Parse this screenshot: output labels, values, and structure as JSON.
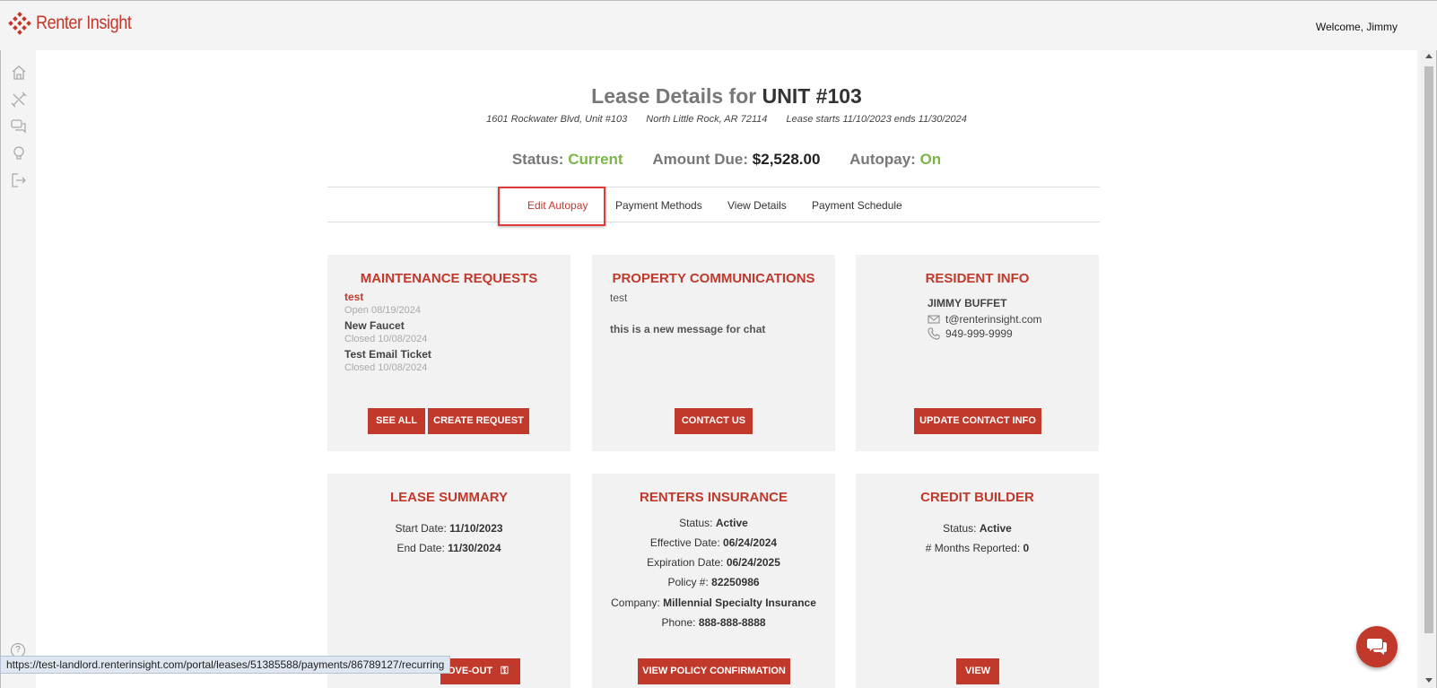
{
  "brand": {
    "name": "Renter Insight",
    "accent": "#c0392b"
  },
  "header": {
    "welcome": "Welcome, Jimmy"
  },
  "nav": {
    "icons": [
      "home-icon",
      "tools-icon",
      "chat-icon",
      "lightbulb-icon",
      "logout-icon"
    ]
  },
  "lease": {
    "title_prefix": "Lease Details for",
    "unit": "UNIT #103",
    "address": "1601 Rockwater Blvd, Unit #103",
    "city": "North Little Rock, AR 72114",
    "term": "Lease starts 11/10/2023 ends 11/30/2024"
  },
  "status_line": {
    "status_label": "Status:",
    "status_value": "Current",
    "amount_label": "Amount Due:",
    "amount_value": "$2,528.00",
    "autopay_label": "Autopay:",
    "autopay_value": "On"
  },
  "tabs": [
    {
      "label": "Edit Autopay",
      "active": true
    },
    {
      "label": "Payment Methods"
    },
    {
      "label": "View Details"
    },
    {
      "label": "Payment Schedule"
    }
  ],
  "maintenance": {
    "title": "MAINTENANCE REQUESTS",
    "items": [
      {
        "name": "test",
        "status": "Open 08/19/2024"
      },
      {
        "name": "New Faucet",
        "status": "Closed 10/08/2024"
      },
      {
        "name": "Test Email Ticket",
        "status": "Closed 10/08/2024"
      }
    ],
    "see_all": "SEE ALL",
    "create": "CREATE REQUEST"
  },
  "communications": {
    "title": "PROPERTY COMMUNICATIONS",
    "line1": "test",
    "line2": "this is a new message for chat",
    "contact": "CONTACT US"
  },
  "resident": {
    "title": "RESIDENT INFO",
    "name": "JIMMY BUFFET",
    "email": "t@renterinsight.com",
    "phone": "949-999-9999",
    "update": "UPDATE CONTACT INFO"
  },
  "lease_summary": {
    "title": "LEASE SUMMARY",
    "start_label": "Start Date:",
    "start_value": "11/10/2023",
    "end_label": "End Date:",
    "end_value": "11/30/2024",
    "button_partial": "OVE-OUT"
  },
  "insurance": {
    "title": "RENTERS INSURANCE",
    "rows": [
      {
        "label": "Status:",
        "value": "Active"
      },
      {
        "label": "Effective Date:",
        "value": "06/24/2024"
      },
      {
        "label": "Expiration Date:",
        "value": "06/24/2025"
      },
      {
        "label": "Policy #:",
        "value": "82250986"
      },
      {
        "label": "Company:",
        "value": "Millennial Specialty Insurance"
      },
      {
        "label": "Phone:",
        "value": "888-888-8888"
      }
    ],
    "button": "VIEW POLICY CONFIRMATION"
  },
  "credit": {
    "title": "CREDIT BUILDER",
    "status_label": "Status:",
    "status_value": "Active",
    "months_label": "# Months Reported:",
    "months_value": "0",
    "button": "VIEW"
  },
  "browser_status": {
    "url": "https://test-landlord.renterinsight.com/portal/leases/51385588/payments/86789127/recurring"
  }
}
